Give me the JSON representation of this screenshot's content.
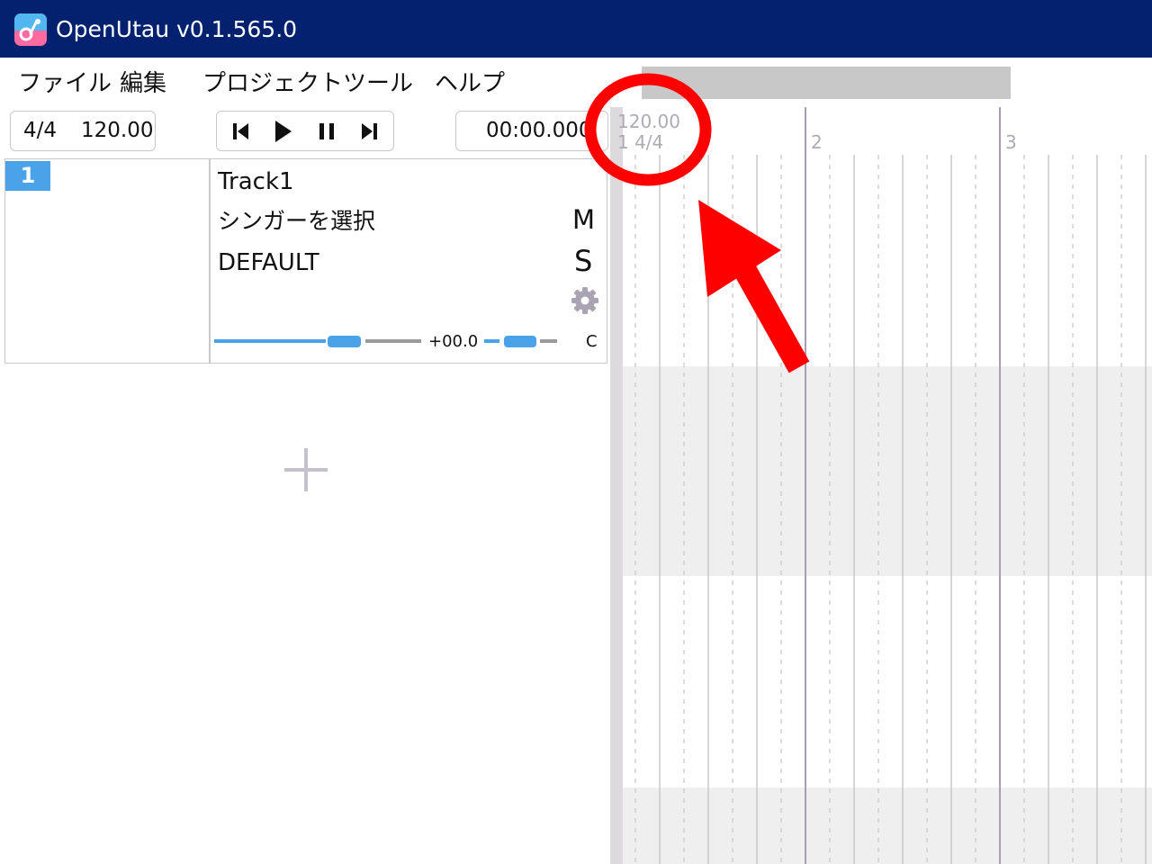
{
  "window": {
    "title": "OpenUtau v0.1.565.0"
  },
  "menu": {
    "items": [
      "ファイル",
      "編集",
      "プロジェクト",
      "ツール",
      "ヘルプ"
    ]
  },
  "toolbar": {
    "time_signature": "4/4",
    "tempo": "120.00",
    "playback_time": "00:00.000",
    "transport": [
      "skip-to-start-icon",
      "play-icon",
      "pause-icon",
      "skip-to-end-icon"
    ]
  },
  "track": {
    "number": "1",
    "name": "Track1",
    "singer": "シンガーを選択",
    "phonemizer": "DEFAULT",
    "mute_label": "M",
    "solo_label": "S",
    "volume": "+00.0",
    "pan": "C"
  },
  "timeline": {
    "tempo_marker": "120.00",
    "bar1_label": "1 4/4",
    "bar2_label": "2",
    "bar3_label": "3"
  },
  "colors": {
    "titlebar": "#03216f",
    "accent": "#4aa3e8",
    "annotation": "#ff0000",
    "grid_label": "#aeaab5"
  }
}
